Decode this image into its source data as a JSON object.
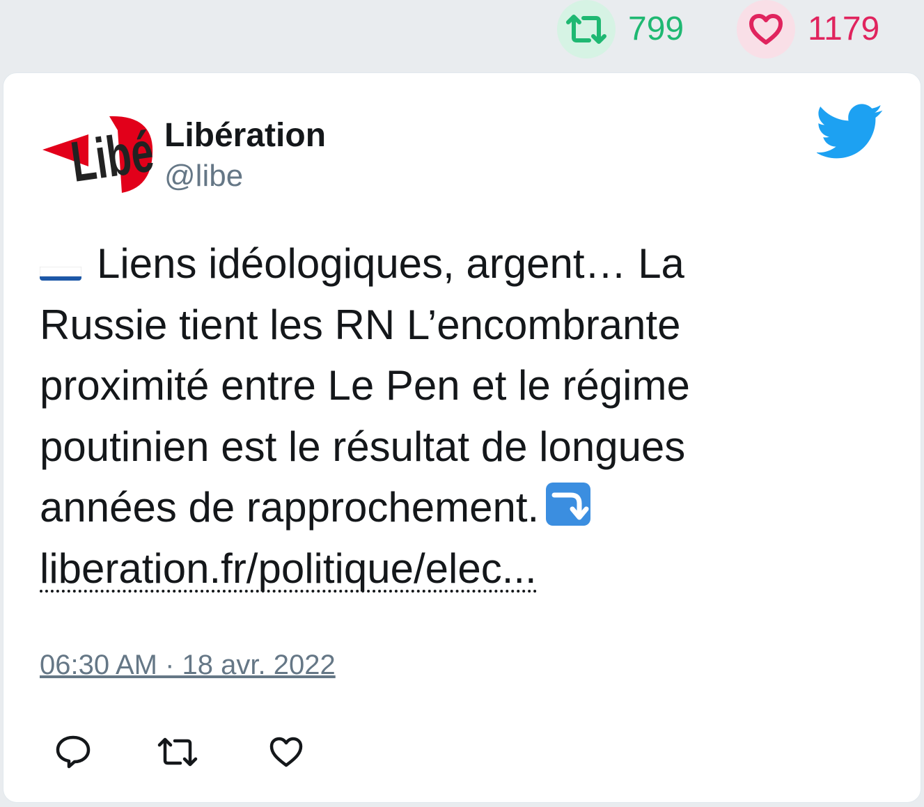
{
  "stats": {
    "retweets": "799",
    "likes": "1179",
    "retweet_icon": "retweet-icon",
    "like_icon": "heart-icon",
    "retweet_color": "#1fb872",
    "like_color": "#e0245e"
  },
  "tweet": {
    "author_name": "Libération",
    "author_handle": "@libe",
    "avatar_icon": "libe-logo",
    "logo_text": "Libé",
    "brand_icon": "twitter-bird-icon",
    "flag_icon": "russia-flag-icon",
    "text": "Liens idéologiques, argent… La Russie tient les RN L’encombrante proximité entre Le Pen et le régime poutinien est le résultat de longues années de rapprochement.",
    "arrow_icon": "right-arrow-curving-down-icon",
    "link_text": "liberation.fr/politique/elec...",
    "timestamp": "06:30 AM · 18 avr. 2022"
  },
  "actions": [
    {
      "name": "reply",
      "icon": "reply-icon"
    },
    {
      "name": "retweet",
      "icon": "retweet-icon"
    },
    {
      "name": "like",
      "icon": "heart-icon"
    }
  ],
  "colors": {
    "twitter_blue": "#1da1f2",
    "text": "#14171a",
    "muted": "#657786"
  }
}
